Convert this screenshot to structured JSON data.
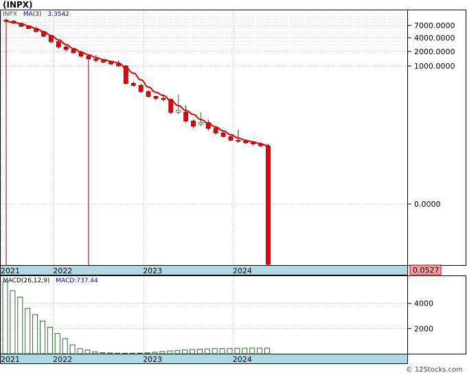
{
  "header": {
    "ticker_title": "(INPX)"
  },
  "price_legend": {
    "symbol": "INPX",
    "ma_label": "MA(3)",
    "ma_value": "3.3542"
  },
  "macd_legend": {
    "params": "MACD(26,12,9)",
    "value_label": "MACD:737.44"
  },
  "last_price_tag": "0.0527",
  "credit": "© 12Stocks.com",
  "colors": {
    "down": "#e8000f",
    "up": "#ffffff",
    "ma": "#e00000",
    "grid": "#aaaaaa",
    "axis_band": "#add8e6",
    "macd_bar": "#2e6b2e",
    "price_tag_bg": "#f5a0a0"
  },
  "chart_data": [
    {
      "type": "candlestick",
      "scale": "log",
      "y_tick_labels": [
        "7000.0000",
        "4000.0000",
        "2000.0000",
        "1000.0000",
        "0.0000"
      ],
      "x_tick_labels": [
        "2021",
        "2022",
        "2023",
        "2024"
      ],
      "candles": [
        {
          "o": 9000,
          "h": 9800,
          "l": 0.01,
          "c": 8500
        },
        {
          "o": 8600,
          "h": 9000,
          "l": 7500,
          "c": 7800
        },
        {
          "o": 7800,
          "h": 8000,
          "l": 6500,
          "c": 6700
        },
        {
          "o": 6700,
          "h": 7000,
          "l": 5800,
          "c": 6000
        },
        {
          "o": 6000,
          "h": 6600,
          "l": 5000,
          "c": 5200
        },
        {
          "o": 5200,
          "h": 5400,
          "l": 4000,
          "c": 4200
        },
        {
          "o": 4200,
          "h": 4400,
          "l": 3000,
          "c": 3200
        },
        {
          "o": 3200,
          "h": 3400,
          "l": 2300,
          "c": 2500
        },
        {
          "o": 2500,
          "h": 2700,
          "l": 2000,
          "c": 2200
        },
        {
          "o": 2200,
          "h": 2300,
          "l": 1800,
          "c": 1900
        },
        {
          "o": 1900,
          "h": 2100,
          "l": 1500,
          "c": 1600
        },
        {
          "o": 1600,
          "h": 1700,
          "l": 0.001,
          "c": 1400
        },
        {
          "o": 1400,
          "h": 1700,
          "l": 1200,
          "c": 1300
        },
        {
          "o": 1300,
          "h": 1400,
          "l": 1150,
          "c": 1200
        },
        {
          "o": 1200,
          "h": 1250,
          "l": 1050,
          "c": 1100
        },
        {
          "o": 1100,
          "h": 1300,
          "l": 950,
          "c": 1000
        },
        {
          "o": 1000,
          "h": 1050,
          "l": 400,
          "c": 420
        },
        {
          "o": 420,
          "h": 460,
          "l": 360,
          "c": 380
        },
        {
          "o": 380,
          "h": 420,
          "l": 260,
          "c": 280
        },
        {
          "o": 280,
          "h": 300,
          "l": 210,
          "c": 220
        },
        {
          "o": 220,
          "h": 230,
          "l": 180,
          "c": 200
        },
        {
          "o": 200,
          "h": 250,
          "l": 170,
          "c": 190
        },
        {
          "o": 190,
          "h": 200,
          "l": 90,
          "c": 100
        },
        {
          "o": 100,
          "h": 240,
          "l": 90,
          "c": 110
        },
        {
          "o": 100,
          "h": 140,
          "l": 60,
          "c": 65
        },
        {
          "o": 65,
          "h": 70,
          "l": 45,
          "c": 50
        },
        {
          "o": 55,
          "h": 100,
          "l": 50,
          "c": 60
        },
        {
          "o": 60,
          "h": 70,
          "l": 40,
          "c": 45
        },
        {
          "o": 45,
          "h": 52,
          "l": 33,
          "c": 36
        },
        {
          "o": 36,
          "h": 40,
          "l": 29,
          "c": 30
        },
        {
          "o": 30,
          "h": 33,
          "l": 24,
          "c": 25
        },
        {
          "o": 25,
          "h": 42,
          "l": 22,
          "c": 24
        },
        {
          "o": 24,
          "h": 26,
          "l": 21,
          "c": 22
        },
        {
          "o": 22,
          "h": 24,
          "l": 19,
          "c": 21
        },
        {
          "o": 21,
          "h": 23,
          "l": 18,
          "c": 19
        },
        {
          "o": 19,
          "h": 21,
          "l": 0.0005,
          "c": 0.0527
        }
      ],
      "ma": [
        8500,
        8100,
        7600,
        6800,
        6000,
        5200,
        4300,
        3500,
        2800,
        2300,
        1950,
        1700,
        1500,
        1350,
        1250,
        1150,
        900,
        700,
        500,
        350,
        270,
        230,
        180,
        140,
        110,
        90,
        70,
        58,
        48,
        40,
        33,
        28,
        25,
        23,
        21,
        19
      ]
    },
    {
      "type": "bar",
      "title": "MACD(26,12,9)",
      "y_tick_labels": [
        "4000",
        "2000"
      ],
      "x_tick_labels": [
        "2021",
        "2022",
        "2023",
        "2024"
      ],
      "values": [
        5700,
        5000,
        4500,
        3600,
        3100,
        2600,
        2100,
        1600,
        1200,
        700,
        400,
        300,
        150,
        80,
        60,
        40,
        40,
        40,
        50,
        70,
        120,
        170,
        220,
        260,
        300,
        330,
        360,
        380,
        400,
        410,
        420,
        430,
        430,
        440,
        440,
        440
      ]
    }
  ]
}
